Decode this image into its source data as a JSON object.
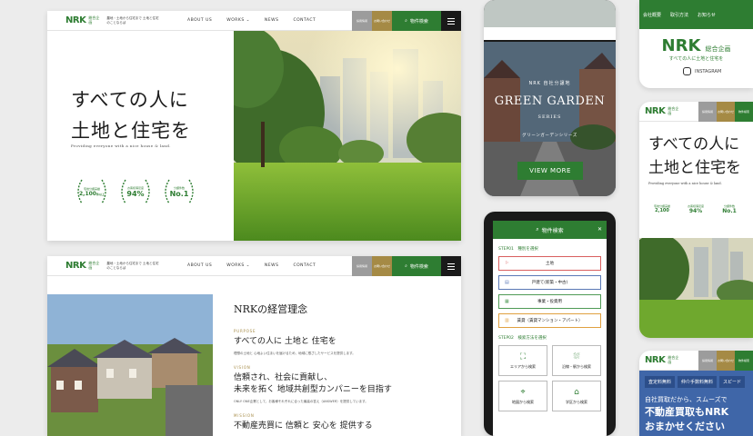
{
  "brand": {
    "logo": "NRK",
    "logo_sub": "総合企画",
    "tagline": "農地・土地から住宅まで 土地と住宅のことならば"
  },
  "nav": {
    "about": "ABOUT US",
    "works": "WORKS",
    "news": "NEWS",
    "contact": "CONTACT"
  },
  "header_buttons": {
    "b1": "採用情報",
    "b2": "お問い合わせ",
    "search": "物件検索"
  },
  "hero": {
    "title_line1": "すべての人に",
    "title_line2": "土地と住宅を",
    "subtitle": "Providing everyone with a nice house & land.",
    "badges": [
      {
        "label": "宅地分譲実績",
        "value": "2,100",
        "unit": "件以上"
      },
      {
        "label": "お客様満足度",
        "value": "94%"
      },
      {
        "label": "分譲件数",
        "value": "No.1"
      }
    ]
  },
  "philosophy": {
    "heading": "NRKの経営理念",
    "purpose_label": "PURPOSE",
    "purpose_text": "すべての人に 土地と 住宅を",
    "purpose_note": "理想の土地と 心地よい住まいを届けるため、地域に根ざしたサービスを提供します。",
    "vision_label": "VISION",
    "vision_text_1": "信頼され、社会に貢献し、",
    "vision_text_2": "未来を拓く 地域共創型カンパニーを目指す",
    "vision_note": "ONLY ONE企業として、お客様それぞれに合った最高の答え（ANSWER）を提供しています。",
    "mission_label": "MISSION",
    "mission_text": "不動産売買に 信頼と 安心を 提供する"
  },
  "garden": {
    "pre": "NRK 自社分譲地",
    "title": "GREEN GARDEN",
    "series": "SERIES",
    "sub": "グリーンガーデンシリーズ",
    "button": "VIEW MORE"
  },
  "search_panel": {
    "title": "物件検索",
    "close": "✕",
    "step1": "STEP01　種別を選択",
    "options": [
      "土地",
      "戸建て(新築・中古)",
      "事業・投資用",
      "賃貸（賃貸マンション・アパート）"
    ],
    "step2": "STEP02　検索方法を選択",
    "methods": [
      "エリアから検索",
      "沿線・駅から検索",
      "地図から検索",
      "学区から検索"
    ]
  },
  "right_top": {
    "links": [
      "会社概要",
      "取引方法",
      "お知らせ"
    ],
    "instagram": "INSTAGRAM",
    "logo_tag": "すべての人に土地と住宅を"
  },
  "right_mid": {
    "title_line1": "すべての人に",
    "title_line2": "土地と住宅を",
    "subtitle": "Providing everyone with a nice house & land."
  },
  "right_bottom": {
    "tabs": [
      "査定料無料",
      "仲介手数料無料",
      "スピード"
    ],
    "line1": "自社買取だから、スムーズで",
    "line2": "不動産買取もNRK",
    "line3": "おまかせください"
  }
}
